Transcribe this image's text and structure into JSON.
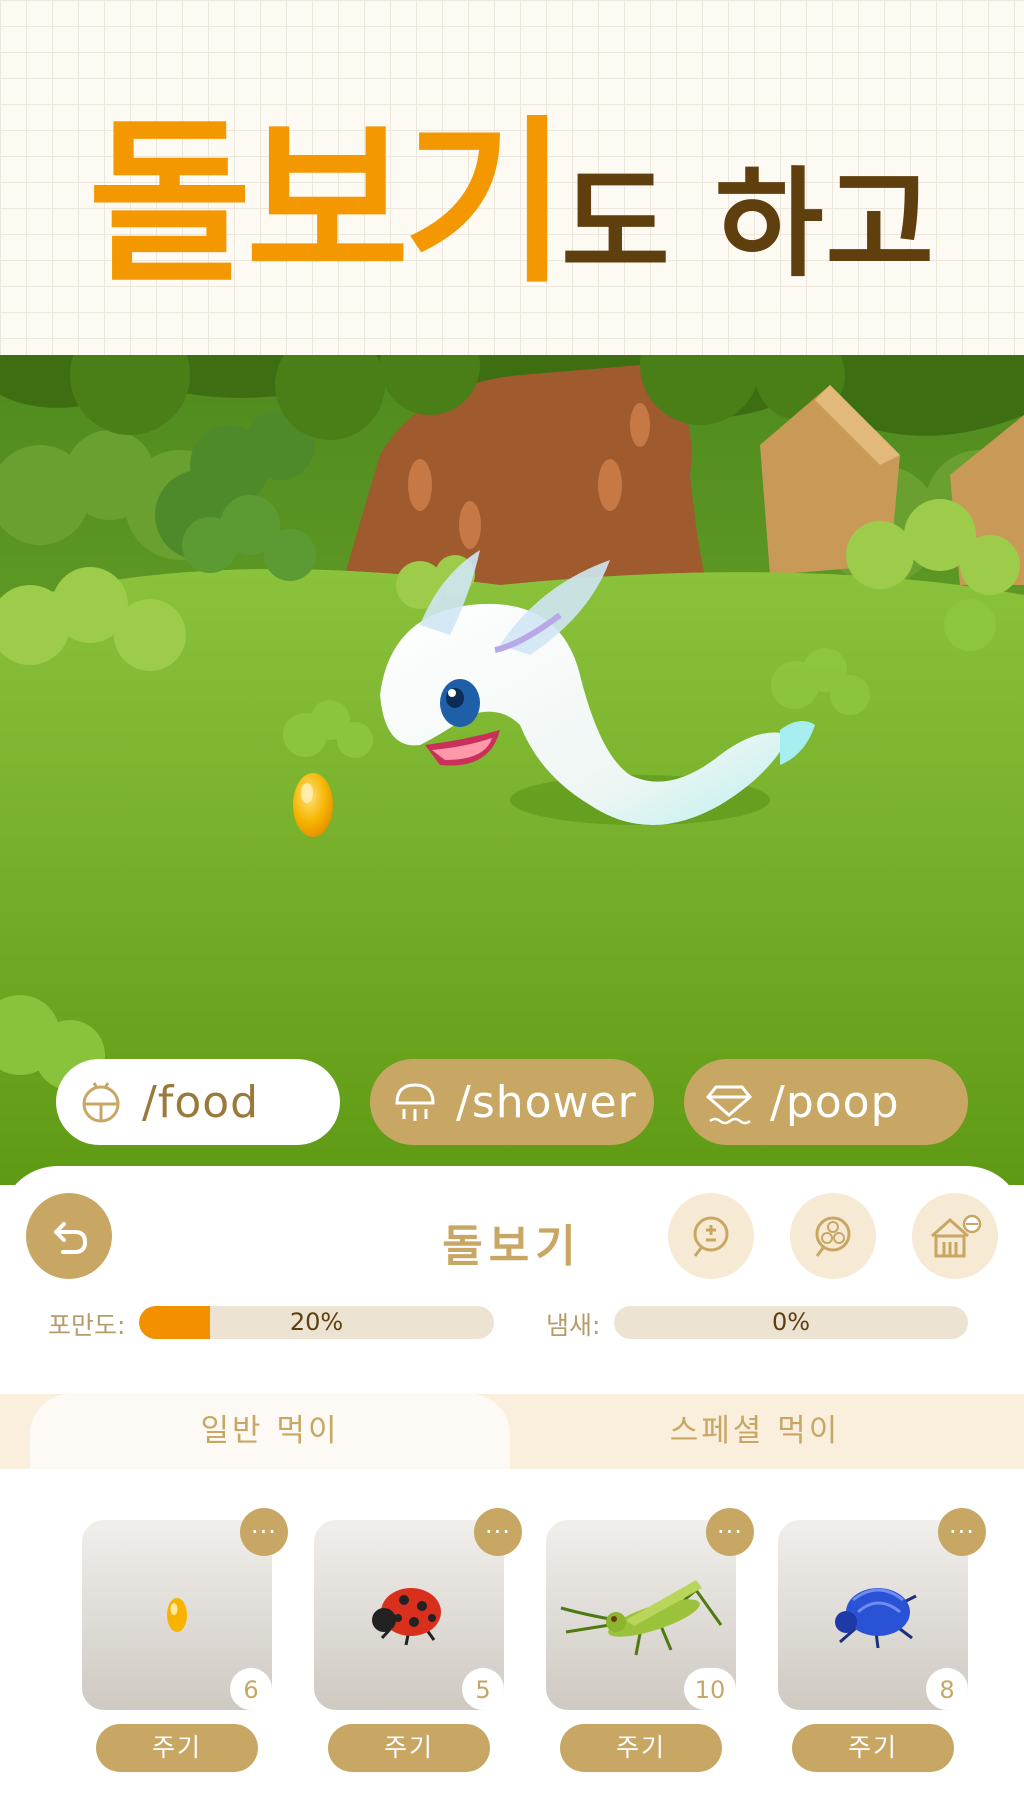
{
  "headline": {
    "big": "돌보기",
    "small": "도 하고"
  },
  "scene": {
    "pet": "white-slug-pet",
    "food_item": "amber-food-pellet"
  },
  "actions": [
    {
      "icon": "bug-icon",
      "label": "/food"
    },
    {
      "icon": "shower-icon",
      "label": "/shower"
    },
    {
      "icon": "gem-icon",
      "label": "/poop"
    }
  ],
  "panel": {
    "title": "돌보기",
    "fullness": {
      "label": "포만도:",
      "value_text": "20%",
      "value": 0.2
    },
    "smell": {
      "label": "냄새:",
      "value_text": "0%",
      "value": 0.0
    }
  },
  "tabs": {
    "normal": "일반 먹이",
    "special": "스페셜 먹이",
    "active": "normal"
  },
  "foods": [
    {
      "name": "amber-pellet",
      "count": "6",
      "button": "주기"
    },
    {
      "name": "ladybug",
      "count": "5",
      "button": "주기"
    },
    {
      "name": "grasshopper",
      "count": "10",
      "button": "주기"
    },
    {
      "name": "blue-beetle",
      "count": "8",
      "button": "주기"
    }
  ],
  "more_symbol": "···",
  "colors": {
    "accent_orange": "#f39800",
    "brown_text": "#5e3f0d",
    "gold": "#c8a765",
    "grass": "#6ea820"
  }
}
